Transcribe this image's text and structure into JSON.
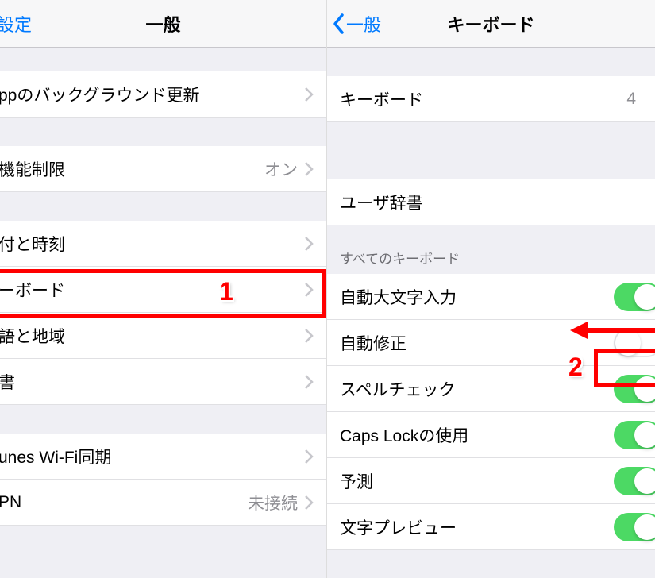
{
  "left": {
    "nav_back": "設定",
    "nav_title": "一般",
    "rows": {
      "bg_refresh": "ppのバックグラウンド更新",
      "restrictions": "機能制限",
      "restrictions_value": "オン",
      "date_time": "付と時刻",
      "keyboard": "ーボード",
      "lang_region": "語と地域",
      "dictionary": "書",
      "itunes": "unes Wi-Fi同期",
      "vpn": "PN",
      "vpn_value": "未接続"
    }
  },
  "right": {
    "nav_back": "一般",
    "nav_title": "キーボード",
    "rows": {
      "keyboards": "キーボード",
      "keyboards_count": "4",
      "user_dict": "ユーザ辞書",
      "section_label": "すべてのキーボード",
      "auto_caps": "自動大文字入力",
      "auto_correct": "自動修正",
      "spell_check": "スペルチェック",
      "caps_lock": "Caps Lockの使用",
      "predictive": "予測",
      "char_preview": "文字プレビュー"
    }
  },
  "annotations": {
    "num1": "1",
    "num2": "2"
  }
}
